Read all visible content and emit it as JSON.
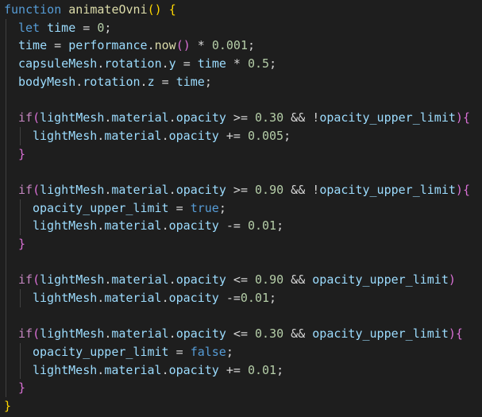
{
  "editor": {
    "colors": {
      "background": "#1e1e1e",
      "keyword_storage": "#569cd6",
      "keyword_control": "#c586c0",
      "function": "#dcdcaa",
      "variable": "#9cdcfe",
      "number": "#b5cea8",
      "punctuation": "#d4d4d4",
      "bracket_level1": "#ffd700",
      "bracket_level2": "#da70d6",
      "bracket_level3": "#179fff"
    },
    "lines": [
      {
        "indent": 0,
        "tokens": [
          [
            "kw-storage",
            "function"
          ],
          [
            "op",
            " "
          ],
          [
            "fn",
            "animateOvni"
          ],
          [
            "br1",
            "()"
          ],
          [
            "op",
            " "
          ],
          [
            "br1",
            "{"
          ]
        ]
      },
      {
        "indent": 1,
        "tokens": [
          [
            "kw-storage",
            "let"
          ],
          [
            "op",
            " "
          ],
          [
            "var",
            "time"
          ],
          [
            "op",
            " = "
          ],
          [
            "num",
            "0"
          ],
          [
            "punc",
            ";"
          ]
        ]
      },
      {
        "indent": 1,
        "tokens": [
          [
            "var",
            "time"
          ],
          [
            "op",
            " = "
          ],
          [
            "var",
            "performance"
          ],
          [
            "punc",
            "."
          ],
          [
            "fn",
            "now"
          ],
          [
            "br2",
            "()"
          ],
          [
            "op",
            " * "
          ],
          [
            "num",
            "0.001"
          ],
          [
            "punc",
            ";"
          ]
        ]
      },
      {
        "indent": 1,
        "tokens": [
          [
            "var",
            "capsuleMesh"
          ],
          [
            "punc",
            "."
          ],
          [
            "var",
            "rotation"
          ],
          [
            "punc",
            "."
          ],
          [
            "var",
            "y"
          ],
          [
            "op",
            " = "
          ],
          [
            "var",
            "time"
          ],
          [
            "op",
            " * "
          ],
          [
            "num",
            "0.5"
          ],
          [
            "punc",
            ";"
          ]
        ]
      },
      {
        "indent": 1,
        "tokens": [
          [
            "var",
            "bodyMesh"
          ],
          [
            "punc",
            "."
          ],
          [
            "var",
            "rotation"
          ],
          [
            "punc",
            "."
          ],
          [
            "var",
            "z"
          ],
          [
            "op",
            " = "
          ],
          [
            "var",
            "time"
          ],
          [
            "punc",
            ";"
          ]
        ]
      },
      {
        "indent": 1,
        "tokens": []
      },
      {
        "indent": 1,
        "tokens": [
          [
            "kw-control",
            "if"
          ],
          [
            "br2",
            "("
          ],
          [
            "var",
            "lightMesh"
          ],
          [
            "punc",
            "."
          ],
          [
            "var",
            "material"
          ],
          [
            "punc",
            "."
          ],
          [
            "var",
            "opacity"
          ],
          [
            "op",
            " >= "
          ],
          [
            "num",
            "0.30"
          ],
          [
            "op",
            " && !"
          ],
          [
            "var",
            "opacity_upper_limit"
          ],
          [
            "br2",
            ")"
          ],
          [
            "br2",
            "{"
          ]
        ]
      },
      {
        "indent": 2,
        "tokens": [
          [
            "var",
            "lightMesh"
          ],
          [
            "punc",
            "."
          ],
          [
            "var",
            "material"
          ],
          [
            "punc",
            "."
          ],
          [
            "var",
            "opacity"
          ],
          [
            "op",
            " += "
          ],
          [
            "num",
            "0.005"
          ],
          [
            "punc",
            ";"
          ]
        ]
      },
      {
        "indent": 1,
        "tokens": [
          [
            "br2",
            "}"
          ]
        ]
      },
      {
        "indent": 1,
        "tokens": []
      },
      {
        "indent": 1,
        "tokens": [
          [
            "kw-control",
            "if"
          ],
          [
            "br2",
            "("
          ],
          [
            "var",
            "lightMesh"
          ],
          [
            "punc",
            "."
          ],
          [
            "var",
            "material"
          ],
          [
            "punc",
            "."
          ],
          [
            "var",
            "opacity"
          ],
          [
            "op",
            " >= "
          ],
          [
            "num",
            "0.90"
          ],
          [
            "op",
            " && !"
          ],
          [
            "var",
            "opacity_upper_limit"
          ],
          [
            "br2",
            ")"
          ],
          [
            "br2",
            "{"
          ]
        ]
      },
      {
        "indent": 2,
        "tokens": [
          [
            "var",
            "opacity_upper_limit"
          ],
          [
            "op",
            " = "
          ],
          [
            "bool",
            "true"
          ],
          [
            "punc",
            ";"
          ]
        ]
      },
      {
        "indent": 2,
        "tokens": [
          [
            "var",
            "lightMesh"
          ],
          [
            "punc",
            "."
          ],
          [
            "var",
            "material"
          ],
          [
            "punc",
            "."
          ],
          [
            "var",
            "opacity"
          ],
          [
            "op",
            " -= "
          ],
          [
            "num",
            "0.01"
          ],
          [
            "punc",
            ";"
          ]
        ]
      },
      {
        "indent": 1,
        "tokens": [
          [
            "br2",
            "}"
          ]
        ]
      },
      {
        "indent": 1,
        "tokens": []
      },
      {
        "indent": 1,
        "tokens": [
          [
            "kw-control",
            "if"
          ],
          [
            "br2",
            "("
          ],
          [
            "var",
            "lightMesh"
          ],
          [
            "punc",
            "."
          ],
          [
            "var",
            "material"
          ],
          [
            "punc",
            "."
          ],
          [
            "var",
            "opacity"
          ],
          [
            "op",
            " <= "
          ],
          [
            "num",
            "0.90"
          ],
          [
            "op",
            " && "
          ],
          [
            "var",
            "opacity_upper_limit"
          ],
          [
            "br2",
            ")"
          ]
        ]
      },
      {
        "indent": 2,
        "tokens": [
          [
            "var",
            "lightMesh"
          ],
          [
            "punc",
            "."
          ],
          [
            "var",
            "material"
          ],
          [
            "punc",
            "."
          ],
          [
            "var",
            "opacity"
          ],
          [
            "op",
            " -="
          ],
          [
            "num",
            "0.01"
          ],
          [
            "punc",
            ";"
          ]
        ]
      },
      {
        "indent": 1,
        "tokens": []
      },
      {
        "indent": 1,
        "tokens": [
          [
            "kw-control",
            "if"
          ],
          [
            "br2",
            "("
          ],
          [
            "var",
            "lightMesh"
          ],
          [
            "punc",
            "."
          ],
          [
            "var",
            "material"
          ],
          [
            "punc",
            "."
          ],
          [
            "var",
            "opacity"
          ],
          [
            "op",
            " <= "
          ],
          [
            "num",
            "0.30"
          ],
          [
            "op",
            " && "
          ],
          [
            "var",
            "opacity_upper_limit"
          ],
          [
            "br2",
            ")"
          ],
          [
            "br2",
            "{"
          ]
        ]
      },
      {
        "indent": 2,
        "tokens": [
          [
            "var",
            "opacity_upper_limit"
          ],
          [
            "op",
            " = "
          ],
          [
            "bool",
            "false"
          ],
          [
            "punc",
            ";"
          ]
        ]
      },
      {
        "indent": 2,
        "tokens": [
          [
            "var",
            "lightMesh"
          ],
          [
            "punc",
            "."
          ],
          [
            "var",
            "material"
          ],
          [
            "punc",
            "."
          ],
          [
            "var",
            "opacity"
          ],
          [
            "op",
            " += "
          ],
          [
            "num",
            "0.01"
          ],
          [
            "punc",
            ";"
          ]
        ]
      },
      {
        "indent": 1,
        "tokens": [
          [
            "br2",
            "}"
          ]
        ]
      },
      {
        "indent": 0,
        "tokens": [
          [
            "br1",
            "}"
          ]
        ]
      }
    ]
  }
}
